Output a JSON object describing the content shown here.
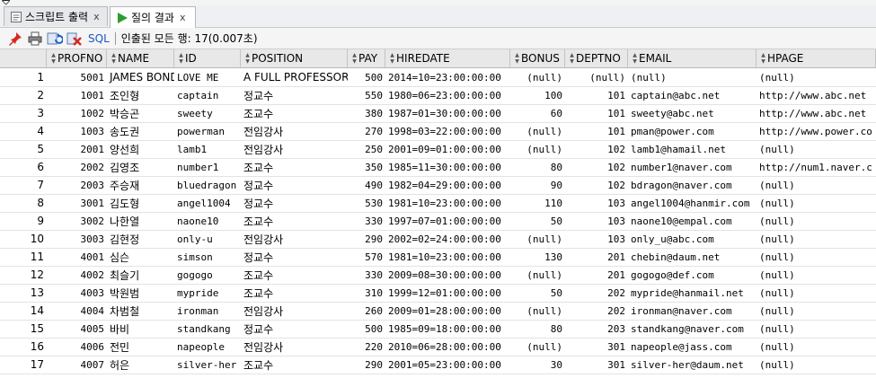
{
  "tabs": [
    {
      "label": "스크립트 출력",
      "close": "x",
      "icon": "script-output-icon"
    },
    {
      "label": "질의 결과",
      "close": "x",
      "icon": "run-triangle-icon"
    }
  ],
  "toolbar": {
    "icons": [
      "pin-icon",
      "print-icon",
      "refresh-icon",
      "delete-icon"
    ],
    "sql_label": "SQL",
    "status": "인출된 모든 행: 17(0.007초)"
  },
  "colors": {
    "run_green": "#2e9d2e",
    "sql_blue": "#1a56c6",
    "pin_red": "#d42a1f"
  },
  "columns": [
    "PROFNO",
    "NAME",
    "ID",
    "POSITION",
    "PAY",
    "HIREDATE",
    "BONUS",
    "DEPTNO",
    "EMAIL",
    "HPAGE"
  ],
  "rows": [
    {
      "rn": "1",
      "profno": "5001",
      "name": "JAMES BOND",
      "id": "LOVE ME",
      "position": "A FULL PROFESSOR",
      "pay": "500",
      "hiredate": "2014=10=23:00:00:00",
      "bonus": "(null)",
      "deptno": "(null)",
      "email": "(null)",
      "hpage": "(null)"
    },
    {
      "rn": "2",
      "profno": "1001",
      "name": "조인형",
      "id": "captain",
      "position": "정교수",
      "pay": "550",
      "hiredate": "1980=06=23:00:00:00",
      "bonus": "100",
      "deptno": "101",
      "email": "captain@abc.net",
      "hpage": "http://www.abc.net"
    },
    {
      "rn": "3",
      "profno": "1002",
      "name": "박승곤",
      "id": "sweety",
      "position": "조교수",
      "pay": "380",
      "hiredate": "1987=01=30:00:00:00",
      "bonus": "60",
      "deptno": "101",
      "email": "sweety@abc.net",
      "hpage": "http://www.abc.net"
    },
    {
      "rn": "4",
      "profno": "1003",
      "name": "송도권",
      "id": "powerman",
      "position": "전임강사",
      "pay": "270",
      "hiredate": "1998=03=22:00:00:00",
      "bonus": "(null)",
      "deptno": "101",
      "email": "pman@power.com",
      "hpage": "http://www.power.co"
    },
    {
      "rn": "5",
      "profno": "2001",
      "name": "양선희",
      "id": "lamb1",
      "position": "전임강사",
      "pay": "250",
      "hiredate": "2001=09=01:00:00:00",
      "bonus": "(null)",
      "deptno": "102",
      "email": "lamb1@hamail.net",
      "hpage": "(null)"
    },
    {
      "rn": "6",
      "profno": "2002",
      "name": "김영조",
      "id": "number1",
      "position": "조교수",
      "pay": "350",
      "hiredate": "1985=11=30:00:00:00",
      "bonus": "80",
      "deptno": "102",
      "email": "number1@naver.com",
      "hpage": "http://num1.naver.c"
    },
    {
      "rn": "7",
      "profno": "2003",
      "name": "주승재",
      "id": "bluedragon",
      "position": "정교수",
      "pay": "490",
      "hiredate": "1982=04=29:00:00:00",
      "bonus": "90",
      "deptno": "102",
      "email": "bdragon@naver.com",
      "hpage": "(null)"
    },
    {
      "rn": "8",
      "profno": "3001",
      "name": "김도형",
      "id": "angel1004",
      "position": "정교수",
      "pay": "530",
      "hiredate": "1981=10=23:00:00:00",
      "bonus": "110",
      "deptno": "103",
      "email": "angel1004@hanmir.com",
      "hpage": "(null)"
    },
    {
      "rn": "9",
      "profno": "3002",
      "name": "나한열",
      "id": "naone10",
      "position": "조교수",
      "pay": "330",
      "hiredate": "1997=07=01:00:00:00",
      "bonus": "50",
      "deptno": "103",
      "email": "naone10@empal.com",
      "hpage": "(null)"
    },
    {
      "rn": "10",
      "profno": "3003",
      "name": "김현정",
      "id": "only-u",
      "position": "전임강사",
      "pay": "290",
      "hiredate": "2002=02=24:00:00:00",
      "bonus": "(null)",
      "deptno": "103",
      "email": "only_u@abc.com",
      "hpage": "(null)"
    },
    {
      "rn": "11",
      "profno": "4001",
      "name": "심슨",
      "id": "simson",
      "position": "정교수",
      "pay": "570",
      "hiredate": "1981=10=23:00:00:00",
      "bonus": "130",
      "deptno": "201",
      "email": "chebin@daum.net",
      "hpage": "(null)"
    },
    {
      "rn": "12",
      "profno": "4002",
      "name": "최슬기",
      "id": "gogogo",
      "position": "조교수",
      "pay": "330",
      "hiredate": "2009=08=30:00:00:00",
      "bonus": "(null)",
      "deptno": "201",
      "email": "gogogo@def.com",
      "hpage": "(null)"
    },
    {
      "rn": "13",
      "profno": "4003",
      "name": "박원범",
      "id": "mypride",
      "position": "조교수",
      "pay": "310",
      "hiredate": "1999=12=01:00:00:00",
      "bonus": "50",
      "deptno": "202",
      "email": "mypride@hanmail.net",
      "hpage": "(null)"
    },
    {
      "rn": "14",
      "profno": "4004",
      "name": "차범철",
      "id": "ironman",
      "position": "전임강사",
      "pay": "260",
      "hiredate": "2009=01=28:00:00:00",
      "bonus": "(null)",
      "deptno": "202",
      "email": "ironman@naver.com",
      "hpage": "(null)"
    },
    {
      "rn": "15",
      "profno": "4005",
      "name": "바비",
      "id": "standkang",
      "position": "정교수",
      "pay": "500",
      "hiredate": "1985=09=18:00:00:00",
      "bonus": "80",
      "deptno": "203",
      "email": "standkang@naver.com",
      "hpage": "(null)"
    },
    {
      "rn": "16",
      "profno": "4006",
      "name": "전민",
      "id": "napeople",
      "position": "전임강사",
      "pay": "220",
      "hiredate": "2010=06=28:00:00:00",
      "bonus": "(null)",
      "deptno": "301",
      "email": "napeople@jass.com",
      "hpage": "(null)"
    },
    {
      "rn": "17",
      "profno": "4007",
      "name": "허은",
      "id": "silver-her",
      "position": "조교수",
      "pay": "290",
      "hiredate": "2001=05=23:00:00:00",
      "bonus": "30",
      "deptno": "301",
      "email": "silver-her@daum.net",
      "hpage": "(null)"
    }
  ]
}
